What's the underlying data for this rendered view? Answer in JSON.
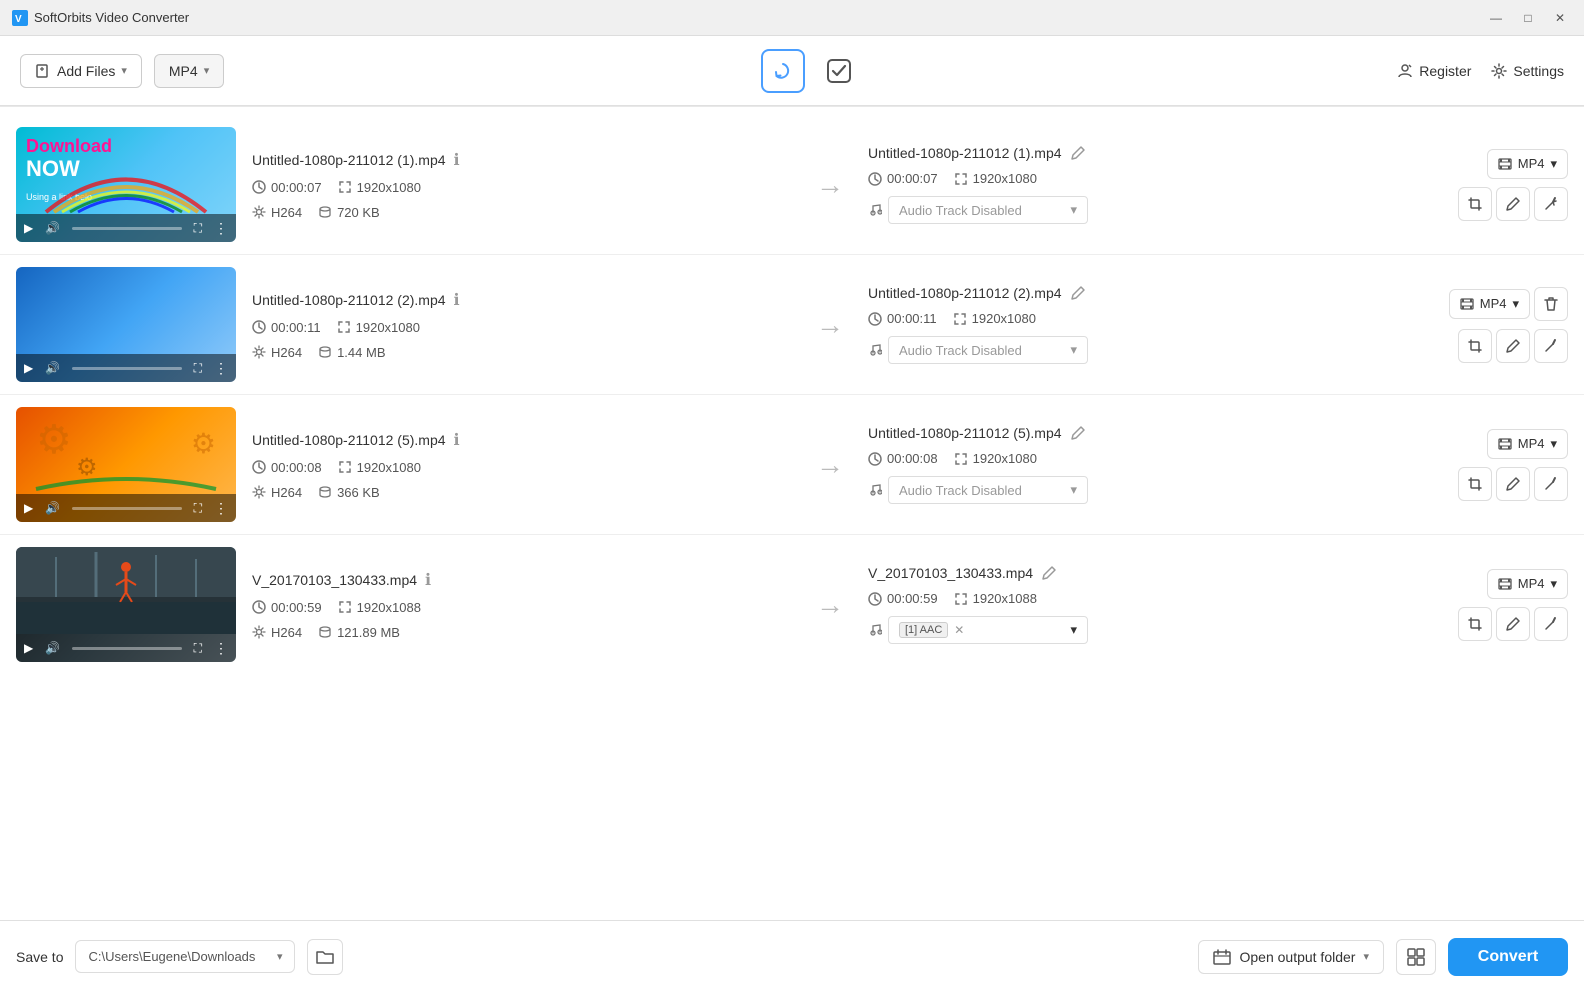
{
  "app": {
    "title": "SoftOrbits Video Converter",
    "titlebar_controls": {
      "minimize": "—",
      "maximize": "□",
      "close": "✕"
    }
  },
  "toolbar": {
    "add_files_label": "Add Files",
    "format_label": "MP4",
    "register_label": "Register",
    "settings_label": "Settings"
  },
  "files": [
    {
      "id": 1,
      "source_name": "Untitled-1080p-211012 (1).mp4",
      "source_duration": "00:00:07",
      "source_resolution": "1920x1080",
      "source_codec": "H264",
      "source_size": "720 KB",
      "output_name": "Untitled-1080p-211012 (1).mp4",
      "output_duration": "00:00:07",
      "output_resolution": "1920x1080",
      "audio_track": "Audio Track Disabled",
      "format": "MP4",
      "thumb_type": "1"
    },
    {
      "id": 2,
      "source_name": "Untitled-1080p-211012 (2).mp4",
      "source_duration": "00:00:11",
      "source_resolution": "1920x1080",
      "source_codec": "H264",
      "source_size": "1.44 MB",
      "output_name": "Untitled-1080p-211012 (2).mp4",
      "output_duration": "00:00:11",
      "output_resolution": "1920x1080",
      "audio_track": "Audio Track Disabled",
      "format": "MP4",
      "thumb_type": "2"
    },
    {
      "id": 3,
      "source_name": "Untitled-1080p-211012 (5).mp4",
      "source_duration": "00:00:08",
      "source_resolution": "1920x1080",
      "source_codec": "H264",
      "source_size": "366 KB",
      "output_name": "Untitled-1080p-211012 (5).mp4",
      "output_duration": "00:00:08",
      "output_resolution": "1920x1080",
      "audio_track": "Audio Track Disabled",
      "format": "MP4",
      "thumb_type": "3"
    },
    {
      "id": 4,
      "source_name": "V_20170103_130433.mp4",
      "source_duration": "00:00:59",
      "source_resolution": "1920x1088",
      "source_codec": "H264",
      "source_size": "121.89 MB",
      "output_name": "V_20170103_130433.mp4",
      "output_duration": "00:00:59",
      "output_resolution": "1920x1088",
      "audio_track": "AAC",
      "audio_has_tag": true,
      "format": "MP4",
      "thumb_type": "4"
    }
  ],
  "bottom": {
    "save_to_label": "Save to",
    "path": "C:\\Users\\Eugene\\Downloads",
    "open_output_folder_label": "Open output folder",
    "convert_label": "Convert"
  },
  "icons": {
    "clock": "🕐",
    "resize": "⤡",
    "gear": "⚙",
    "database": "🗄",
    "music": "♪",
    "arrow_right": "→",
    "edit": "✎",
    "scissors": "✂",
    "wand": "✦",
    "grid": "⊞",
    "folder": "📁",
    "calendar": "📅",
    "key": "🔑",
    "settings": "⚙",
    "add": "➕",
    "refresh": "↻",
    "check": "✔",
    "trash": "🗑",
    "info": "ℹ",
    "chevron_down": "▾",
    "play": "▶",
    "volume": "🔊",
    "fullscreen": "⛶",
    "more": "⋮",
    "film": "🎞",
    "close": "✕"
  }
}
